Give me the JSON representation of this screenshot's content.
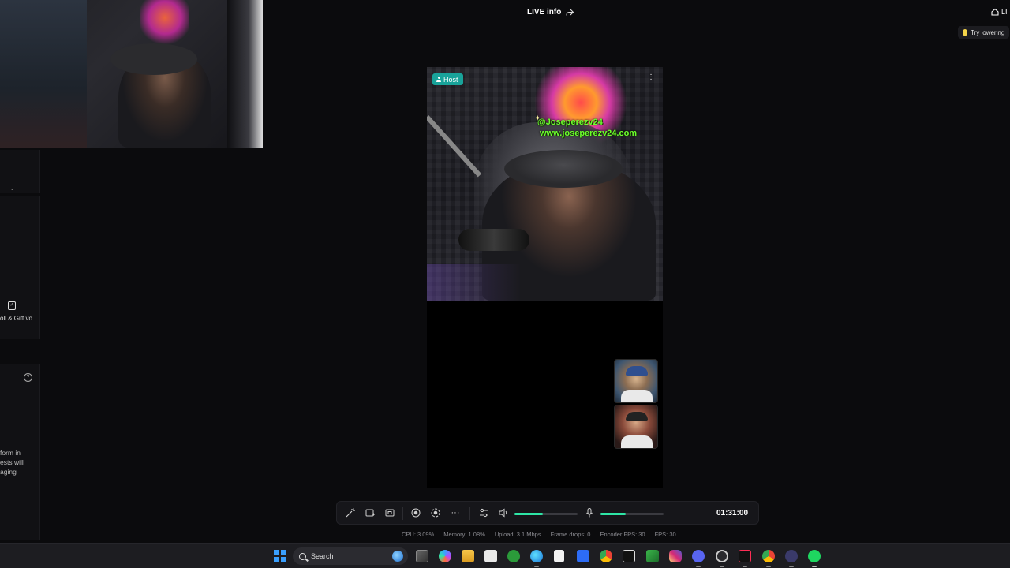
{
  "header": {
    "live_info_label": "LIVE info",
    "home_label": "LI",
    "tip_text": "Try lowering"
  },
  "stage": {
    "host_badge": "Host",
    "overlay_line1": "@Joseperezv24",
    "overlay_line2": "www.joseperezv24.com"
  },
  "sidebar": {
    "vote_label": "oll & Gift vote",
    "help_symbol": "?",
    "info_text": "form in\nests will\naging"
  },
  "controls": {
    "timer": "01:31:00",
    "speaker_volume": 0.45,
    "mic_volume": 0.4
  },
  "stats": {
    "cpu": "CPU: 3.09%",
    "memory": "Memory: 1.08%",
    "upload": "Upload: 3.1 Mbps",
    "frame_drops": "Frame drops: 0",
    "encoder_fps": "Encoder FPS: 30",
    "fps": "FPS: 30"
  },
  "taskbar": {
    "search_label": "Search",
    "apps": [
      "windows-icon",
      "task-view-icon",
      "copilot-icon",
      "file-explorer-icon",
      "store-icon",
      "xbox-icon",
      "edge-icon",
      "notepad-icon",
      "zoom-icon",
      "chrome-icon",
      "capcut-icon",
      "vectorworks-icon",
      "instagram-icon",
      "discord-icon",
      "obs-icon",
      "tiktok-icon",
      "chrome-alt-icon",
      "screen-capture-icon",
      "spotify-icon"
    ]
  },
  "colors": {
    "accent_teal": "#19a39a",
    "slider_green": "#2ee6a6",
    "overlay_green": "#6cff2c"
  }
}
